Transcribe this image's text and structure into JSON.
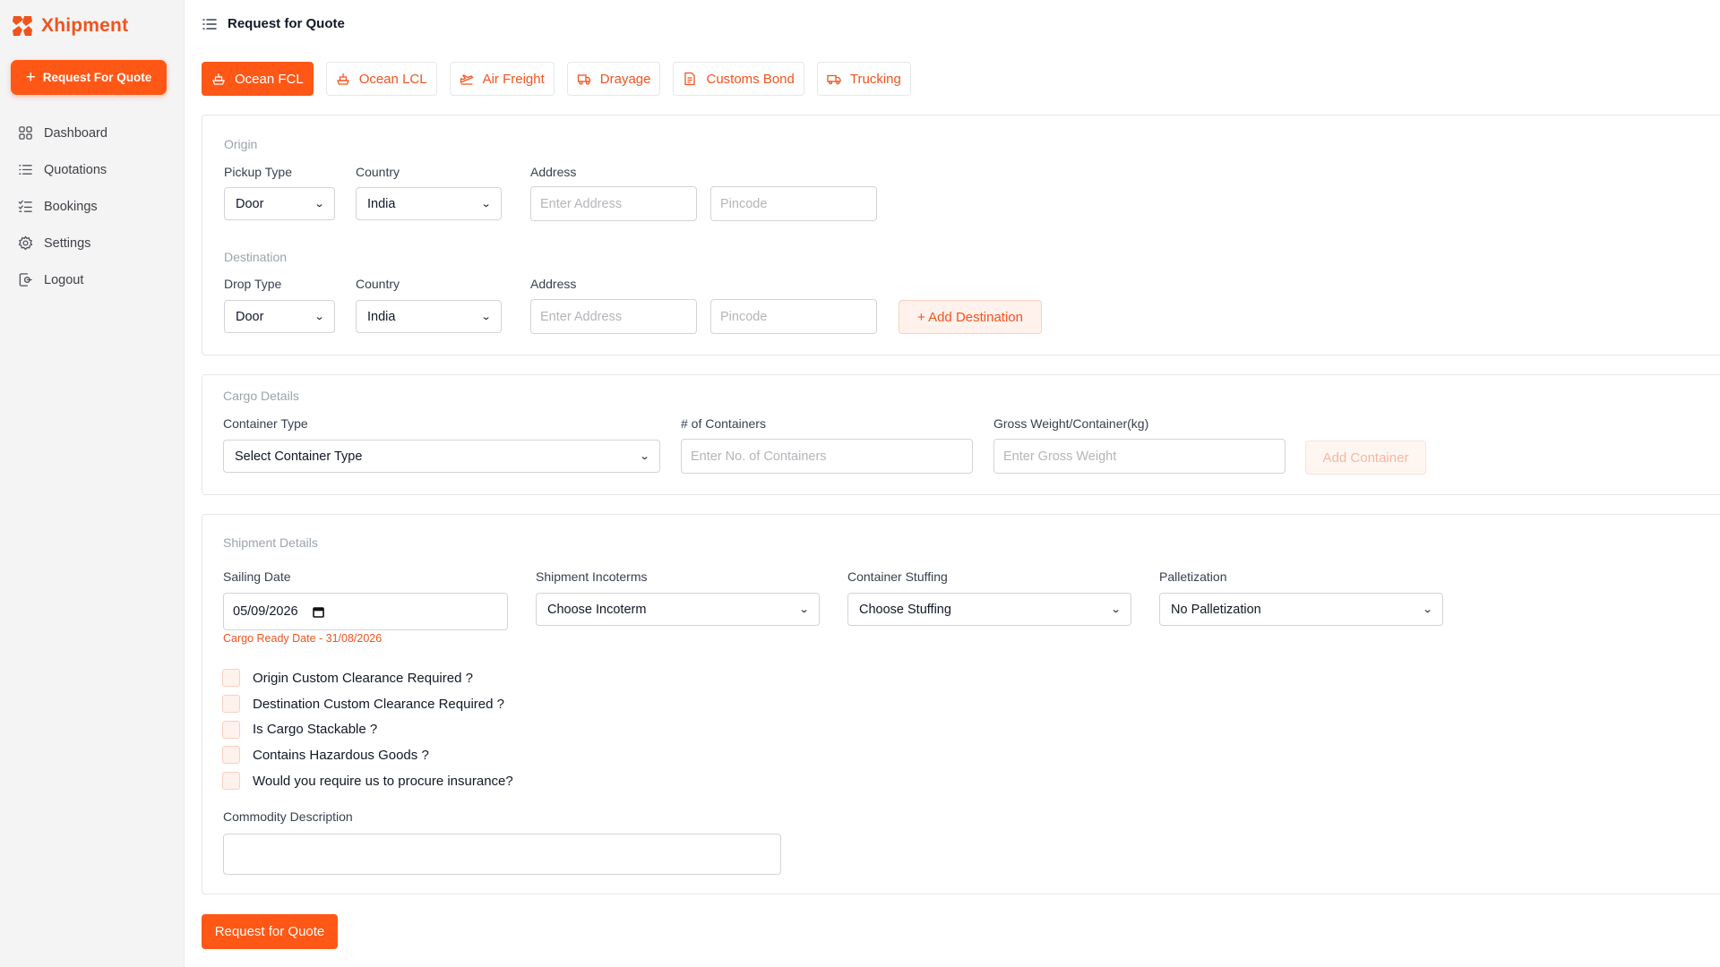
{
  "app": {
    "name": "Xhipment",
    "brand_color": "#ff5716"
  },
  "sidebar": {
    "cta_label": "Request For Quote",
    "items": [
      {
        "label": "Dashboard",
        "icon": "grid-icon"
      },
      {
        "label": "Quotations",
        "icon": "list-icon"
      },
      {
        "label": "Bookings",
        "icon": "checklist-icon"
      },
      {
        "label": "Settings",
        "icon": "gear-icon"
      },
      {
        "label": "Logout",
        "icon": "logout-icon"
      }
    ]
  },
  "header": {
    "title": "Request for Quote"
  },
  "tabs": [
    {
      "label": "Ocean FCL",
      "icon": "ship-icon",
      "active": true
    },
    {
      "label": "Ocean LCL",
      "icon": "ship-icon",
      "active": false
    },
    {
      "label": "Air Freight",
      "icon": "plane-icon",
      "active": false
    },
    {
      "label": "Drayage",
      "icon": "truck-icon",
      "active": false
    },
    {
      "label": "Customs Bond",
      "icon": "document-icon",
      "active": false
    },
    {
      "label": "Trucking",
      "icon": "truck-icon",
      "active": false
    }
  ],
  "origin": {
    "section_label": "Origin",
    "type_label": "Pickup Type",
    "type_value": "Door",
    "country_label": "Country",
    "country_value": "India",
    "address_label": "Address",
    "address_placeholder": "Enter Address",
    "pincode_placeholder": "Pincode"
  },
  "destination": {
    "section_label": "Destination",
    "type_label": "Drop Type",
    "type_value": "Door",
    "country_label": "Country",
    "country_value": "India",
    "address_label": "Address",
    "address_placeholder": "Enter Address",
    "pincode_placeholder": "Pincode",
    "add_label": "+ Add Destination"
  },
  "cargo": {
    "section_label": "Cargo Details",
    "container_type_label": "Container Type",
    "container_type_value": "Select Container Type",
    "count_label": "# of Containers",
    "count_placeholder": "Enter No. of Containers",
    "weight_label": "Gross Weight/Container(kg)",
    "weight_placeholder": "Enter Gross Weight",
    "add_label": "Add Container"
  },
  "shipment": {
    "section_label": "Shipment Details",
    "sailing_label": "Sailing Date",
    "sailing_value": "05/09/2026",
    "ready_hint": "Cargo Ready Date - 31/08/2026",
    "incoterms_label": "Shipment Incoterms",
    "incoterms_value": "Choose Incoterm",
    "stuffing_label": "Container Stuffing",
    "stuffing_value": "Choose Stuffing",
    "pallet_label": "Palletization",
    "pallet_value": "No Palletization",
    "checkboxes": [
      "Origin Custom Clearance Required ?",
      "Destination Custom Clearance Required ?",
      "Is Cargo Stackable ?",
      "Contains Hazardous Goods ?",
      "Would you require us to procure insurance?"
    ],
    "commodity_label": "Commodity Description"
  },
  "submit_label": "Request for Quote"
}
